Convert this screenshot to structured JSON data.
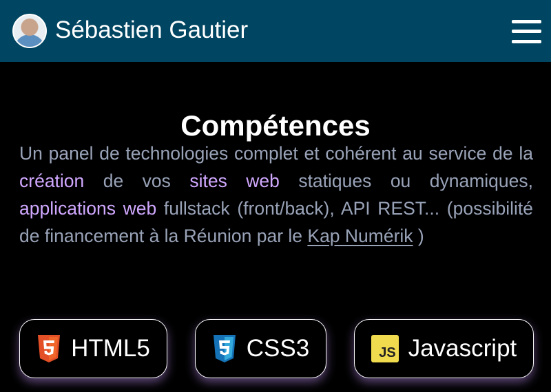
{
  "header": {
    "site_name": "Sébastien Gautier",
    "avatar_alt": "avatar"
  },
  "section": {
    "title": "Compétences",
    "intro": {
      "part1": "Un panel de technologies complet et cohérent au service de la ",
      "hl1": "création",
      "part2": " de vos ",
      "hl2": "sites web",
      "part3": " statiques ou dynamiques, ",
      "hl3": "applications web",
      "part4": " fullstack (front/back), API REST... (possibilité de financement à la Réunion par le ",
      "link": "Kap Numérik",
      "part5": " )"
    }
  },
  "skills": [
    {
      "label": "HTML5",
      "icon": "html5-icon",
      "color": "#e34f26"
    },
    {
      "label": "CSS3",
      "icon": "css3-icon",
      "color": "#1572b6"
    },
    {
      "label": "Javascript",
      "icon": "javascript-icon",
      "color": "#f0db4f",
      "icon_text": "JS"
    }
  ],
  "colors": {
    "header_bg": "#004561",
    "accent": "#d0a8ff",
    "body_text": "#99a3b8"
  }
}
